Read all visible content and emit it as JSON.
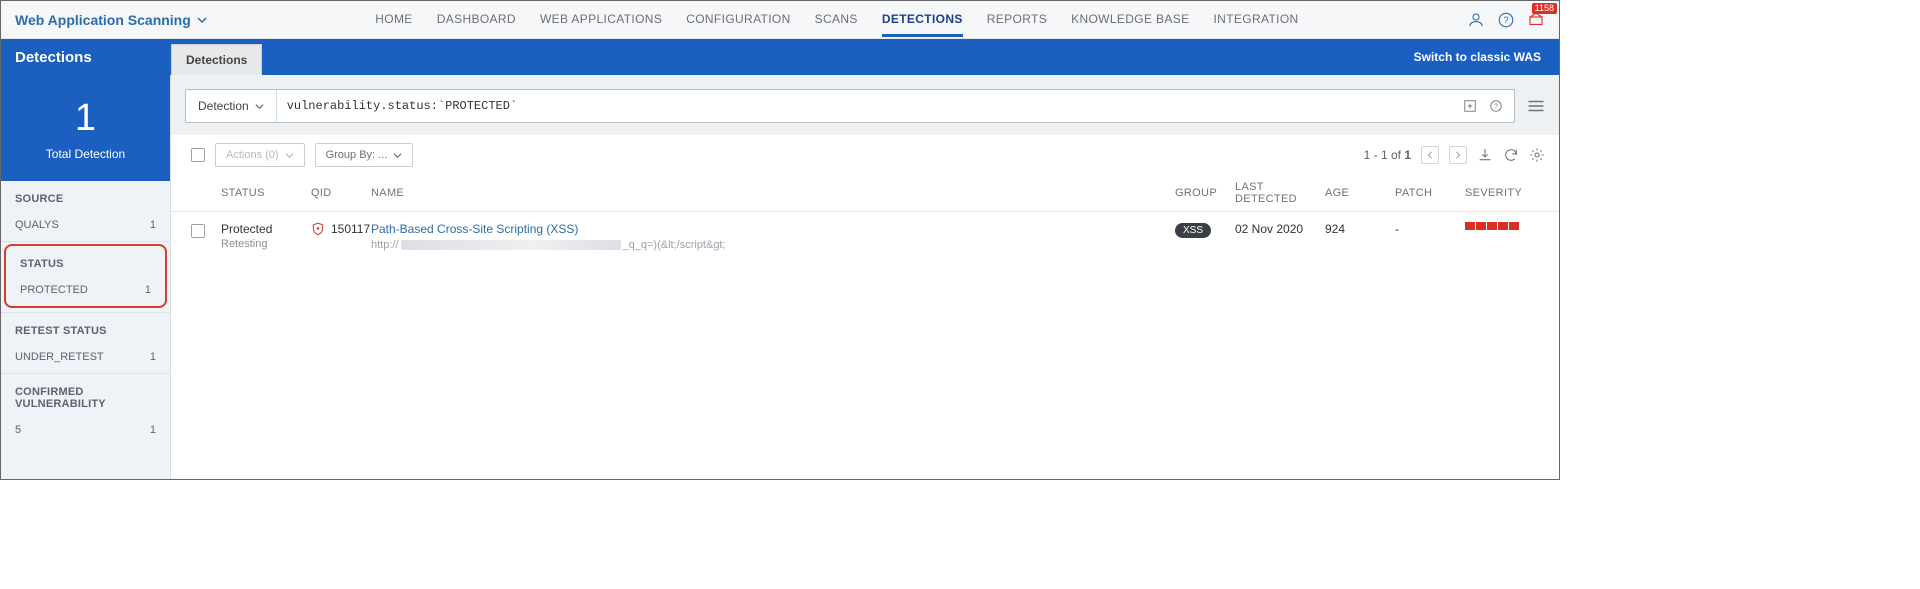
{
  "app": {
    "name": "Web Application Scanning"
  },
  "nav": {
    "items": [
      "HOME",
      "DASHBOARD",
      "WEB APPLICATIONS",
      "CONFIGURATION",
      "SCANS",
      "DETECTIONS",
      "REPORTS",
      "KNOWLEDGE BASE",
      "INTEGRATION"
    ],
    "activeIndex": 5
  },
  "notifications": {
    "count": "1158"
  },
  "page": {
    "title": "Detections",
    "subtabs": [
      "Detections"
    ],
    "switch_label": "Switch to classic WAS"
  },
  "sidebar": {
    "total": {
      "value": "1",
      "label": "Total Detection"
    },
    "groups": [
      {
        "head": "SOURCE",
        "items": [
          {
            "label": "QUALYS",
            "count": "1"
          }
        ],
        "highlight": false
      },
      {
        "head": "STATUS",
        "items": [
          {
            "label": "PROTECTED",
            "count": "1"
          }
        ],
        "highlight": true
      },
      {
        "head": "RETEST STATUS",
        "items": [
          {
            "label": "UNDER_RETEST",
            "count": "1"
          }
        ],
        "highlight": false
      },
      {
        "head": "CONFIRMED VULNERABILITY",
        "items": [
          {
            "label": "5",
            "count": "1"
          }
        ],
        "highlight": false
      }
    ]
  },
  "search": {
    "mode": "Detection",
    "query": "vulnerability.status:`PROTECTED`"
  },
  "toolbar": {
    "actions_label": "Actions (0)",
    "group_label": "Group By: ...",
    "pager_text": "1 - 1 of",
    "pager_total": "1"
  },
  "columns": {
    "status": "STATUS",
    "qid": "QID",
    "name": "NAME",
    "group": "GROUP",
    "ldet": "LAST DETECTED",
    "age": "AGE",
    "patch": "PATCH",
    "sev": "SEVERITY"
  },
  "rows": [
    {
      "status": "Protected",
      "status_sub": "Retesting",
      "qid": "150117",
      "name": "Path-Based Cross-Site Scripting (XSS)",
      "url_prefix": "http://",
      "url_suffix": "_q_q=)(&lt;/script&gt;",
      "group_pill": "XSS",
      "last_detected": "02 Nov 2020",
      "age": "924",
      "patch": "-"
    }
  ]
}
